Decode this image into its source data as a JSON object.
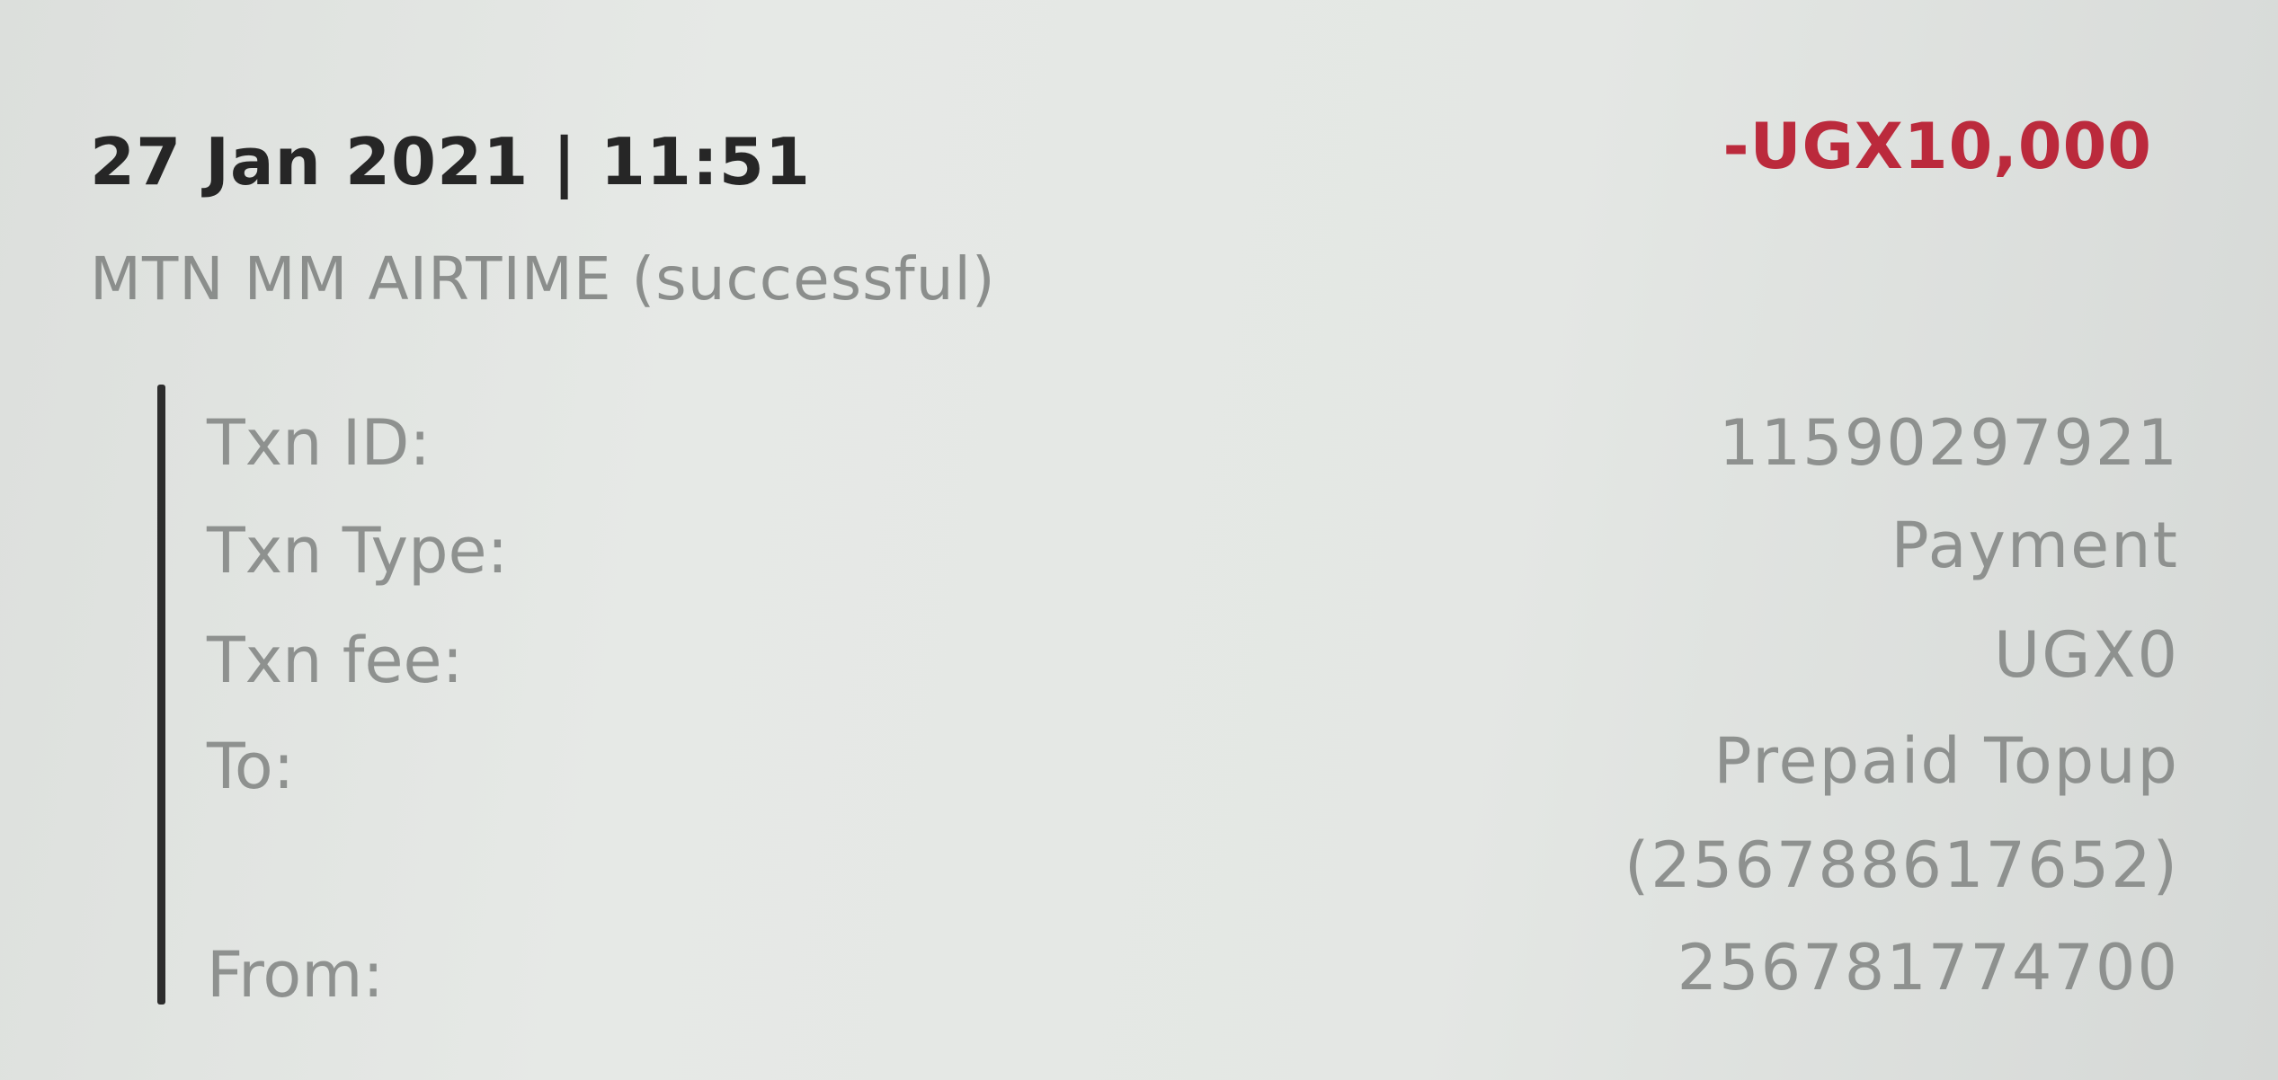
{
  "transaction": {
    "date": "27 Jan 2021",
    "separator": "|",
    "time": "11:51",
    "amount": "-UGX10,000",
    "description": "MTN MM AIRTIME (successful)",
    "colors": {
      "amount": "#bb2a3c",
      "title": "#262626",
      "muted": "#8e918f"
    }
  },
  "details": {
    "txn_id": {
      "label": "Txn ID:",
      "value": "11590297921"
    },
    "txn_type": {
      "label": "Txn Type:",
      "value": "Payment"
    },
    "txn_fee": {
      "label": "Txn fee:",
      "value": "UGX0"
    },
    "to": {
      "label": "To:",
      "value_line1": "Prepaid Topup",
      "value_line2": "(256788617652)"
    },
    "from": {
      "label": "From:",
      "value": "256781774700"
    }
  }
}
